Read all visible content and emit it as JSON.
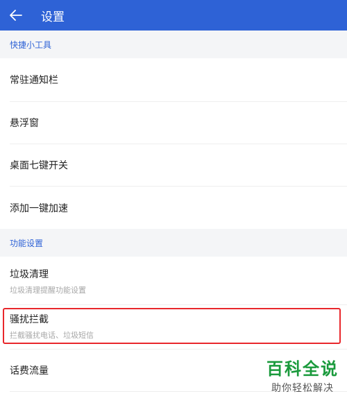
{
  "header": {
    "title": "设置"
  },
  "sections": [
    {
      "title": "快捷小工具",
      "items": [
        "常驻通知栏",
        "悬浮窗",
        "桌面七键开关",
        "添加一键加速"
      ]
    },
    {
      "title": "功能设置",
      "items": [
        {
          "label": "垃圾清理",
          "sub": "垃圾清理提醒功能设置"
        },
        {
          "label": "骚扰拦截",
          "sub": "拦截骚扰电话、垃圾短信"
        },
        {
          "label": "话费流量"
        }
      ]
    }
  ],
  "watermark": {
    "main": "百科全说",
    "sub": "助你轻松解决"
  },
  "colors": {
    "primary": "#2e62d6",
    "highlight": "#e8262b",
    "watermark": "#1a9a3c"
  }
}
